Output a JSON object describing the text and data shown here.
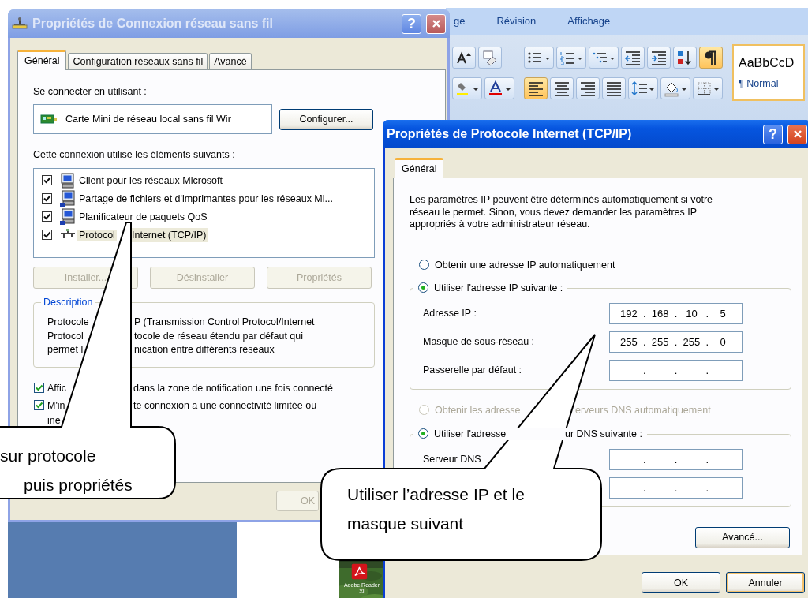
{
  "word_ribbon": {
    "tabs": [
      {
        "label": "ge",
        "selected": false
      },
      {
        "label": "Révision",
        "selected": false
      },
      {
        "label": "Affichage",
        "selected": false
      }
    ],
    "groups": [
      {
        "rows": [
          [
            {
              "kind": "grow_font",
              "active": false
            },
            {
              "kind": "clear_format",
              "active": false
            }
          ],
          [
            {
              "kind": "highlight",
              "active": false
            },
            {
              "kind": "font_color",
              "active": false
            }
          ]
        ]
      },
      {
        "rows": [
          [
            {
              "kind": "bullets",
              "active": false
            },
            {
              "kind": "numbering",
              "active": false
            },
            {
              "kind": "multilevel",
              "active": false
            },
            {
              "kind": "outdent",
              "active": false
            },
            {
              "kind": "indent",
              "active": false
            },
            {
              "kind": "sort",
              "active": false
            },
            {
              "kind": "pilcrow",
              "active": true
            }
          ],
          [
            {
              "kind": "align_left",
              "active": true
            },
            {
              "kind": "align_center",
              "active": false
            },
            {
              "kind": "align_right",
              "active": false
            },
            {
              "kind": "justify",
              "active": false
            },
            {
              "kind": "line_spacing",
              "active": false
            },
            {
              "kind": "shading",
              "active": false
            },
            {
              "kind": "borders",
              "active": false
            }
          ]
        ]
      }
    ],
    "style_gallery": {
      "sample": "AaBbCcD",
      "name": "¶ Normal"
    }
  },
  "network_window": {
    "title": "Propriétés de Connexion réseau sans fil",
    "active": false,
    "help": "?",
    "tabs": [
      {
        "label": "Général",
        "selected": true
      },
      {
        "label": "Configuration réseaux sans fil",
        "selected": false
      },
      {
        "label": "Avancé",
        "selected": false
      }
    ],
    "connect_label": "Se connecter en utilisant :",
    "adapter": "Carte Mini de réseau local sans fil Wir",
    "configure_button": "Configurer...",
    "components_label": "Cette connexion utilise les éléments suivants :",
    "components": [
      {
        "kind": "client",
        "parts": [
          "Client pour les réseaux Microsoft"
        ],
        "checked": true,
        "selected": false
      },
      {
        "kind": "service",
        "parts": [
          "Partage de fichiers et d'imprimantes pour les réseaux Mi..."
        ],
        "checked": true,
        "selected": false
      },
      {
        "kind": "service",
        "parts": [
          "Planificateur de paquets QoS"
        ],
        "checked": true,
        "selected": false
      },
      {
        "kind": "protocol",
        "parts": [
          "Protocol",
          "Internet (TCP/IP)"
        ],
        "checked": true,
        "selected": true
      }
    ],
    "buttons": [
      {
        "label": "Installer...",
        "disabled": true
      },
      {
        "label": "Désinstaller",
        "disabled": true
      },
      {
        "label": "Propriétés",
        "disabled": true
      }
    ],
    "description": {
      "legend": "Description",
      "lines": [
        [
          "Protocole",
          "P (Transmission Control Protocol/Internet"
        ],
        [
          "Protocol",
          "tocole de réseau étendu par défaut qui"
        ],
        [
          "permet l",
          "nication entre différents réseaux"
        ]
      ]
    },
    "options": [
      {
        "parts": [
          "Affic",
          "dans la zone de notification une fois connecté"
        ],
        "checked": true
      },
      {
        "parts": [
          "M'in",
          "te connexion a une connectivité limitée ou"
        ],
        "extra": "ine",
        "checked": true
      }
    ],
    "ok_button": {
      "label": "OK",
      "disabled": true
    }
  },
  "tcpip_window": {
    "title": "Propriétés de Protocole Internet (TCP/IP)",
    "active": true,
    "help": "?",
    "tabs": [
      {
        "label": "Général",
        "selected": true
      }
    ],
    "intro_lines": [
      "Les paramètres IP peuvent être déterminés automatiquement si votre",
      "réseau le permet. Sinon, vous devez demander les paramètres IP",
      "appropriés à votre administrateur réseau."
    ],
    "ip_mode": [
      {
        "parts": [
          "Obtenir une adresse IP automatiquement"
        ],
        "selected": false,
        "disabled": false
      },
      {
        "parts": [
          "Utiliser l'adresse IP suivante :"
        ],
        "selected": true,
        "disabled": false
      }
    ],
    "ip_fields": [
      {
        "label": "Adresse IP :",
        "octets": [
          "192",
          "168",
          "10",
          "5"
        ],
        "separator": "."
      },
      {
        "label": "Masque de sous-réseau :",
        "octets": [
          "255",
          "255",
          "255",
          "0"
        ],
        "separator": "."
      },
      {
        "label": "Passerelle par défaut :",
        "separator": "."
      }
    ],
    "dns_mode": [
      {
        "parts": [
          "Obtenir les adresse",
          "erveurs DNS automatiquement"
        ],
        "selected": false,
        "disabled": true
      },
      {
        "parts": [
          "Utiliser l'adresse",
          "ur DNS suivante :"
        ],
        "selected": true,
        "disabled": false
      }
    ],
    "dns_fields": [
      {
        "label": "Serveur DNS",
        "separator": "."
      },
      {
        "separator": "."
      }
    ],
    "advanced_button": "Avancé...",
    "ok_button": {
      "label": "OK",
      "default": false
    },
    "cancel_button": {
      "label": "Annuler",
      "default": true
    }
  },
  "desktop": {
    "shortcut": "Adobe Reader XI"
  },
  "callouts": [
    {
      "lines": [
        "sur protocole",
        "puis propriétés"
      ]
    },
    {
      "lines": [
        "Utiliser l’adresse IP et le",
        "masque suivant"
      ]
    }
  ]
}
